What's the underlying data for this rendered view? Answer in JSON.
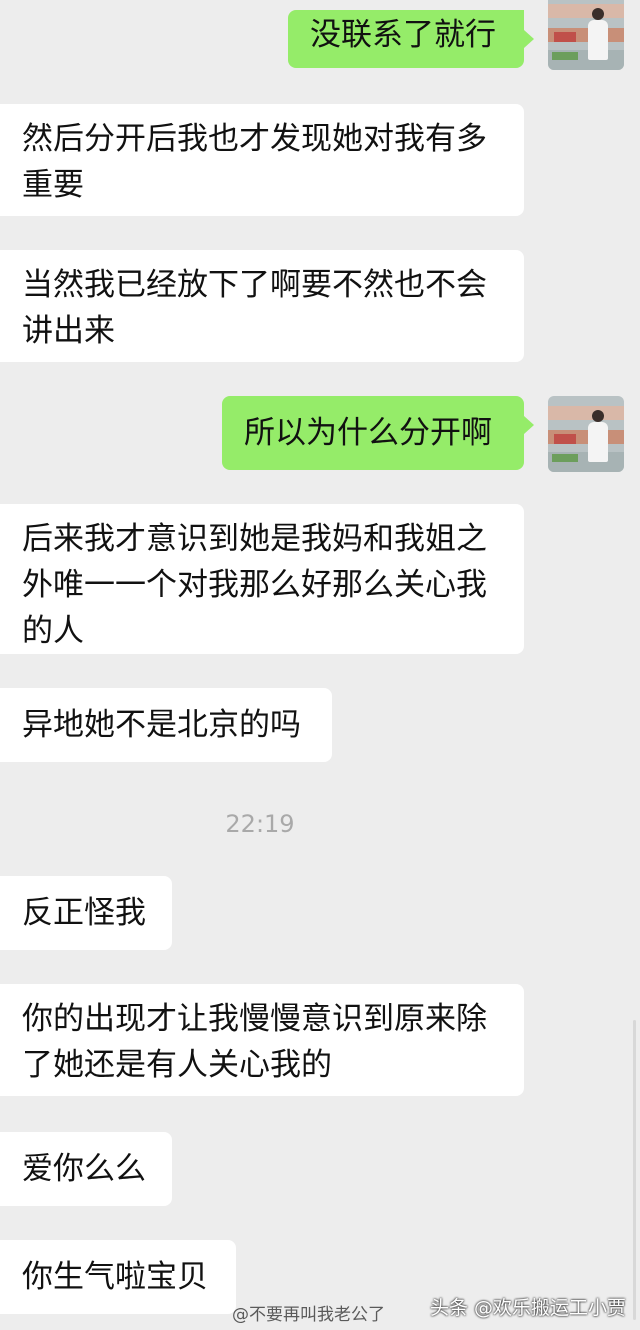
{
  "messages": [
    {
      "id": "m1",
      "side": "sent",
      "text": "没联系了就行"
    },
    {
      "id": "m2",
      "side": "received",
      "text": "然后分开后我也才发现她对我有多重要"
    },
    {
      "id": "m3",
      "side": "received",
      "text": "当然我已经放下了啊要不然也不会讲出来"
    },
    {
      "id": "m4",
      "side": "sent",
      "text": "所以为什么分开啊"
    },
    {
      "id": "m5",
      "side": "received",
      "text": "后来我才意识到她是我妈和我姐之外唯一一个对我那么好那么关心我的人"
    },
    {
      "id": "m6",
      "side": "received",
      "text": "异地她不是北京的吗"
    },
    {
      "id": "m7",
      "side": "received",
      "text": "反正怪我"
    },
    {
      "id": "m8",
      "side": "received",
      "text": "你的出现才让我慢慢意识到原来除了她还是有人关心我的"
    },
    {
      "id": "m9",
      "side": "received",
      "text": "爱你么么"
    },
    {
      "id": "m10",
      "side": "received",
      "text": "你生气啦宝贝"
    }
  ],
  "timestamp": "22:19",
  "watermarks": {
    "weibo": "@不要再叫我老公了",
    "toutiao": "头条 @欢乐搬运工小贾"
  },
  "colors": {
    "background": "#ededed",
    "sent_bubble": "#95ec69",
    "received_bubble": "#ffffff"
  }
}
